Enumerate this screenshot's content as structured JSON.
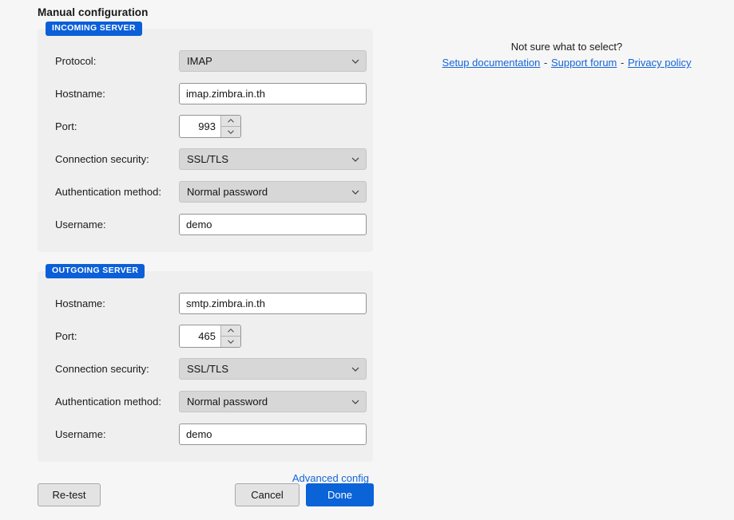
{
  "heading": "Manual configuration",
  "colors": {
    "accent": "#0b5fd8",
    "link": "#1565d8",
    "panel_bg": "#efefef",
    "page_bg": "#f6f6f6",
    "select_bg": "#d7d7d7",
    "primary_button": "#0b63d8"
  },
  "incoming": {
    "badge": "INCOMING SERVER",
    "rows": [
      {
        "label": "Protocol:",
        "type": "select",
        "value": "IMAP"
      },
      {
        "label": "Hostname:",
        "type": "text",
        "value": "imap.zimbra.in.th"
      },
      {
        "label": "Port:",
        "type": "spinner",
        "value": "993"
      },
      {
        "label": "Connection security:",
        "type": "select",
        "value": "SSL/TLS"
      },
      {
        "label": "Authentication method:",
        "type": "select",
        "value": "Normal password"
      },
      {
        "label": "Username:",
        "type": "text",
        "value": "demo"
      }
    ]
  },
  "outgoing": {
    "badge": "OUTGOING SERVER",
    "rows": [
      {
        "label": "Hostname:",
        "type": "text",
        "value": "smtp.zimbra.in.th"
      },
      {
        "label": "Port:",
        "type": "spinner",
        "value": "465"
      },
      {
        "label": "Connection security:",
        "type": "select",
        "value": "SSL/TLS"
      },
      {
        "label": "Authentication method:",
        "type": "select",
        "value": "Normal password"
      },
      {
        "label": "Username:",
        "type": "text",
        "value": "demo"
      }
    ]
  },
  "advanced_config_label": "Advanced config",
  "footer": {
    "retest_label": "Re-test",
    "cancel_label": "Cancel",
    "done_label": "Done"
  },
  "help": {
    "question": "Not sure what to select?",
    "links": [
      {
        "label": "Setup documentation"
      },
      {
        "label": "Support forum"
      },
      {
        "label": "Privacy policy"
      }
    ],
    "separator": "-"
  }
}
